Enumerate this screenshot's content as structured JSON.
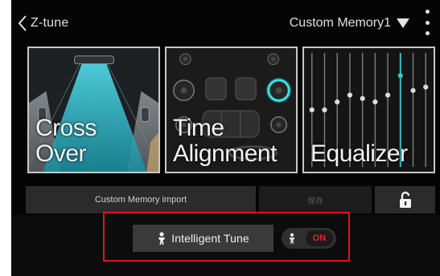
{
  "header": {
    "title": "Z-tune",
    "memory_label": "Custom Memory1"
  },
  "tiles": [
    {
      "line1": "Cross",
      "line2": "Over"
    },
    {
      "line1": "Time",
      "line2": "Alignment"
    },
    {
      "line1": "Equalizer",
      "line2": ""
    }
  ],
  "equalizer": {
    "levels": [
      0.5,
      0.5,
      0.57,
      0.63,
      0.6,
      0.57,
      0.63,
      0.8,
      0.67,
      0.7
    ],
    "active_index": 7,
    "accent_color": "#35c4cf"
  },
  "actions": {
    "import_label": "Custom Memory import",
    "save_label": "保存"
  },
  "intelligent_tune": {
    "label": "Intelligent Tune",
    "toggle_label": "ON",
    "highlight_color": "#e0131c"
  },
  "icons": [
    "back-chevron-icon",
    "dropdown-triangle-icon",
    "more-vert-icon",
    "unlock-icon",
    "person-icon"
  ]
}
